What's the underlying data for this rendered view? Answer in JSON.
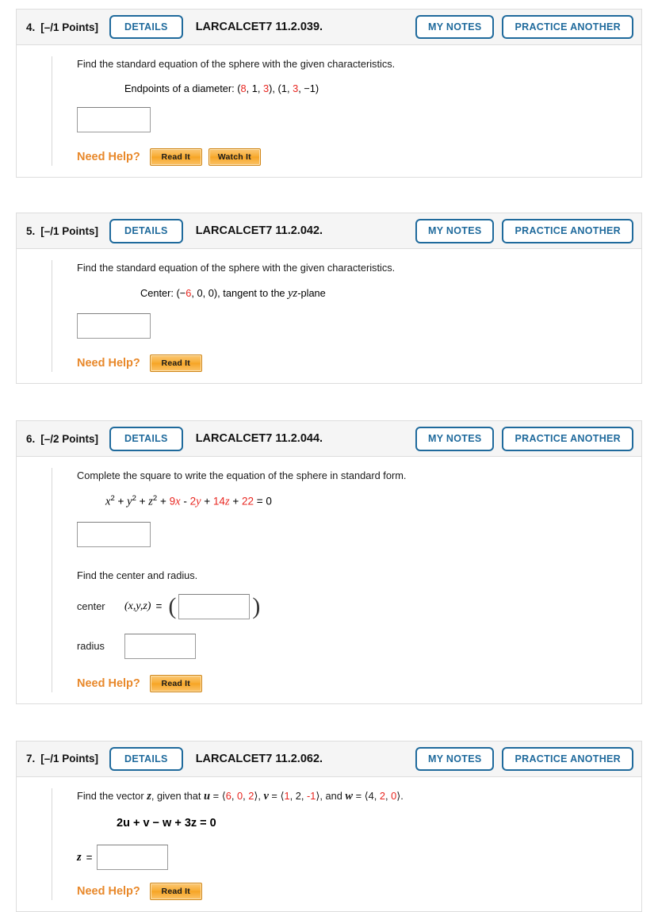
{
  "questions": [
    {
      "number": "4.",
      "points": "[–/1 Points]",
      "details_label": "DETAILS",
      "code": "LARCALCET7 11.2.039.",
      "my_notes_label": "MY NOTES",
      "practice_label": "PRACTICE ANOTHER",
      "prompt": "Find the standard equation of the sphere with the given characteristics.",
      "given_label": "Endpoints of a diameter:",
      "point1": {
        "x": "8",
        "y": "1",
        "z": "3"
      },
      "point2": {
        "x": "1",
        "y": "3",
        "z": "−1"
      },
      "answer_value": "",
      "need_help_label": "Need Help?",
      "help_buttons": [
        "Read It",
        "Watch It"
      ]
    },
    {
      "number": "5.",
      "points": "[–/1 Points]",
      "details_label": "DETAILS",
      "code": "LARCALCET7 11.2.042.",
      "my_notes_label": "MY NOTES",
      "practice_label": "PRACTICE ANOTHER",
      "prompt": "Find the standard equation of the sphere with the given characteristics.",
      "given_label": "Center:",
      "center": {
        "x_sign": "−",
        "x": "6",
        "y": "0",
        "z": "0"
      },
      "tangent_text": "tangent to the",
      "plane": "yz",
      "plane_suffix": "-plane",
      "answer_value": "",
      "need_help_label": "Need Help?",
      "help_buttons": [
        "Read It"
      ]
    },
    {
      "number": "6.",
      "points": "[–/2 Points]",
      "details_label": "DETAILS",
      "code": "LARCALCET7 11.2.044.",
      "my_notes_label": "MY NOTES",
      "practice_label": "PRACTICE ANOTHER",
      "prompt": "Complete the square to write the equation of the sphere in standard form.",
      "equation": {
        "t1_var": "x",
        "t1_exp": "2",
        "t2_var": "y",
        "t2_exp": "2",
        "t3_var": "z",
        "t3_exp": "2",
        "c4": "9",
        "v4": "x",
        "op5": "-",
        "c5": "2",
        "v5": "y",
        "c6": "14",
        "v6": "z",
        "c7": "22",
        "rhs": "= 0"
      },
      "answer_value": "",
      "subprompt": "Find the center and radius.",
      "center_label": "center",
      "center_vars": "(x,y,z)",
      "center_eq": "=",
      "center_value": "",
      "radius_label": "radius",
      "radius_value": "",
      "need_help_label": "Need Help?",
      "help_buttons": [
        "Read It"
      ]
    },
    {
      "number": "7.",
      "points": "[–/1 Points]",
      "details_label": "DETAILS",
      "code": "LARCALCET7 11.2.062.",
      "my_notes_label": "MY NOTES",
      "practice_label": "PRACTICE ANOTHER",
      "prompt_parts": {
        "p1": "Find the vector ",
        "z": "z",
        "p2": ", given that ",
        "u": "u",
        "u_vec": {
          "a": "6",
          "b": "0",
          "c": "2"
        },
        "p3": ", ",
        "v": "v",
        "v_vec": {
          "a": "1",
          "b": "2",
          "c": "-1"
        },
        "p4": ", and ",
        "w": "w",
        "w_vec": {
          "a": "4",
          "b": "2",
          "c": "0"
        },
        "p5": "."
      },
      "equation_text": "2u + v − w + 3z = 0",
      "z_label": "z",
      "z_eq": "=",
      "answer_value": "",
      "need_help_label": "Need Help?",
      "help_buttons": [
        "Read It"
      ]
    }
  ],
  "colors": {
    "accent_blue": "#1f6a9c",
    "red_value": "#e8251f",
    "orange_help": "#e8882a",
    "header_bg": "#f5f5f5",
    "border": "#dddddd"
  }
}
